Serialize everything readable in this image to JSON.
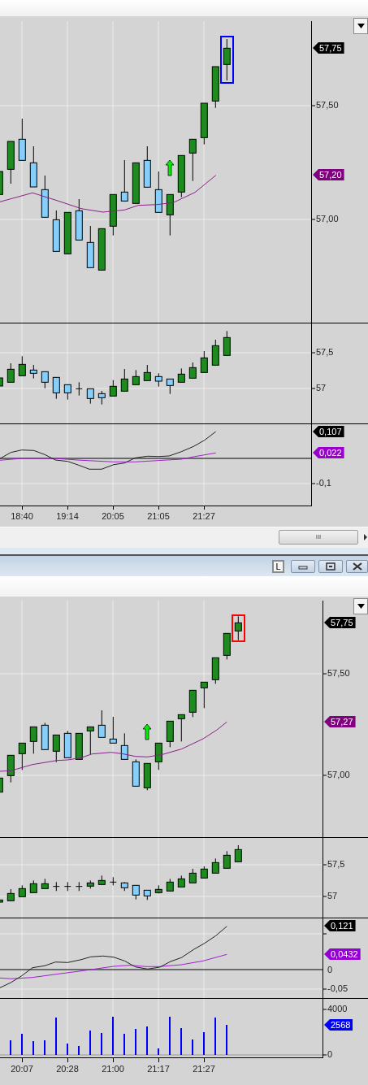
{
  "windows": [
    {
      "color": "#0000ff",
      "panes": [
        {
          "kind": "price",
          "axis_labels": [
            "57,50",
            "57,00"
          ],
          "tags": [
            {
              "text": "57,75",
              "color": "#000000"
            },
            {
              "text": "57,20",
              "color": "#800080"
            }
          ]
        },
        {
          "kind": "candles",
          "axis_labels": [
            "57,5",
            "57"
          ]
        },
        {
          "kind": "oscillator",
          "axis_labels": [
            "-0,1"
          ],
          "tags": [
            {
              "text": "0,107",
              "color": "#000000"
            },
            {
              "text": "0,022",
              "color": "#9900cc"
            }
          ]
        }
      ],
      "time_axis": [
        "18:40",
        "19:14",
        "20:05",
        "21:05",
        "21:27"
      ],
      "scrollbar": {
        "grip": "III"
      }
    },
    {
      "title_bar": {
        "buttons": [
          "L"
        ]
      },
      "color": "#ff0000",
      "panes": [
        {
          "kind": "price",
          "axis_labels": [
            "57,50",
            "57,00"
          ],
          "tags": [
            {
              "text": "57,75",
              "color": "#000000"
            },
            {
              "text": "57,27",
              "color": "#800080"
            }
          ]
        },
        {
          "kind": "candles",
          "axis_labels": [
            "57,5",
            "57"
          ]
        },
        {
          "kind": "oscillator",
          "axis_labels": [
            "0",
            "-0,05"
          ],
          "tags": [
            {
              "text": "0,121",
              "color": "#000000"
            },
            {
              "text": "0,0432",
              "color": "#9400d3"
            }
          ]
        },
        {
          "kind": "volume",
          "axis_labels": [
            "4000",
            "0"
          ],
          "tags": [
            {
              "text": "2568",
              "color": "#0000ff"
            }
          ]
        }
      ],
      "time_axis": [
        "20:07",
        "20:28",
        "21:00",
        "21:17",
        "21:27"
      ]
    }
  ]
}
